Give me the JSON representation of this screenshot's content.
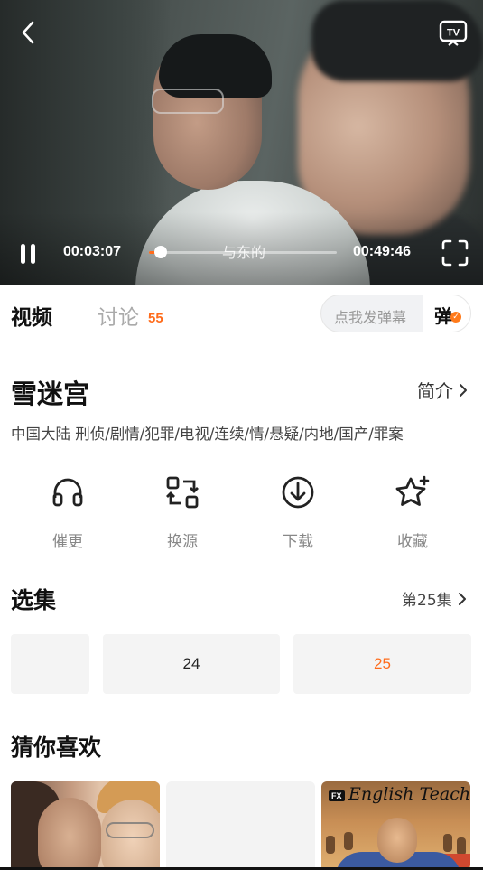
{
  "player": {
    "current_time": "00:03:07",
    "duration": "00:49:46",
    "subtitle": "与东的",
    "progress": 0.063
  },
  "tabs": {
    "video": "视频",
    "discussion": "讨论",
    "discussion_count": "55",
    "danmu_placeholder": "点我发弹幕",
    "danmu_button": "弹"
  },
  "show": {
    "title": "雪迷宫",
    "intro_label": "简介",
    "tags": "中国大陆  刑侦/剧情/犯罪/电视/连续/情/悬疑/内地/国产/罪案"
  },
  "actions": [
    {
      "label": "催更",
      "icon": "headphones-icon"
    },
    {
      "label": "换源",
      "icon": "switch-source-icon"
    },
    {
      "label": "下载",
      "icon": "download-icon"
    },
    {
      "label": "收藏",
      "icon": "star-icon"
    }
  ],
  "episodes": {
    "title": "选集",
    "current_label": "第25集",
    "items": [
      "",
      "24",
      "25"
    ],
    "active": "25"
  },
  "recommend": {
    "title": "猜你喜欢",
    "items": [
      {
        "badge": "",
        "caption": ""
      },
      {
        "badge": "",
        "caption": ""
      },
      {
        "badge": "FX",
        "caption": "English Teacher"
      }
    ]
  },
  "colors": {
    "accent": "#ff6b1a",
    "text_primary": "#111111",
    "text_muted": "#888888",
    "tile_bg": "#f4f4f4"
  }
}
